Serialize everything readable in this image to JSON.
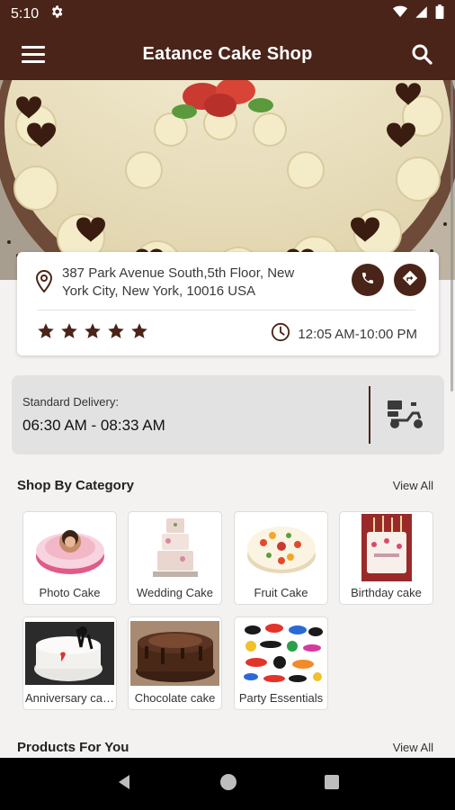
{
  "status_bar": {
    "time": "5:10"
  },
  "app_bar": {
    "title": "Eatance Cake Shop"
  },
  "store": {
    "address": "387 Park Avenue South,5th Floor, New York City, New York, 10016 USA",
    "rating": 5,
    "hours": "12:05 AM-10:00 PM"
  },
  "delivery": {
    "label": "Standard Delivery:",
    "window": "06:30 AM - 08:33 AM"
  },
  "categories_section": {
    "title": "Shop By Category",
    "view_all": "View All",
    "items": [
      {
        "label": "Photo Cake"
      },
      {
        "label": "Wedding Cake"
      },
      {
        "label": "Fruit Cake"
      },
      {
        "label": "Birthday cake"
      },
      {
        "label": "Anniversary cake"
      },
      {
        "label": "Chocolate cake"
      },
      {
        "label": "Party Essentials"
      }
    ]
  },
  "products_section": {
    "title": "Products For You",
    "view_all": "View All"
  },
  "colors": {
    "brand": "#4a2418",
    "background": "#f4f2f1",
    "delivery_panel": "#e2e2e2"
  }
}
